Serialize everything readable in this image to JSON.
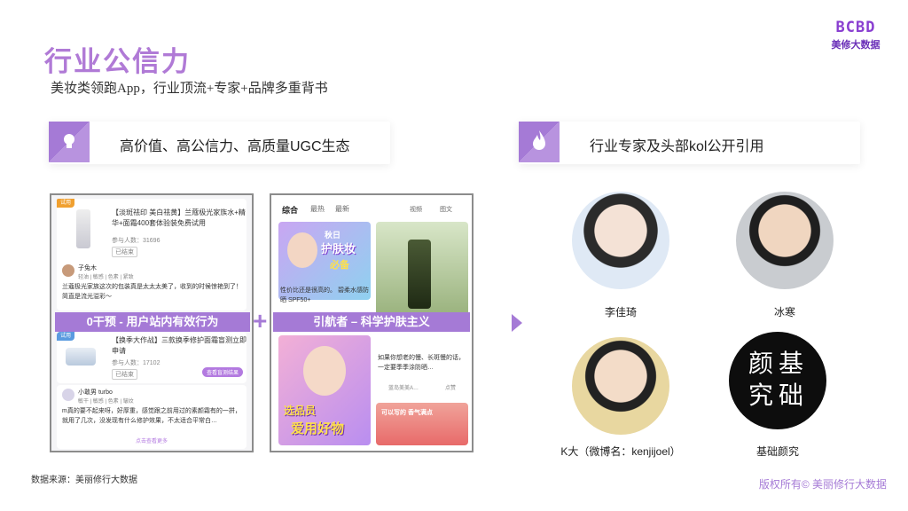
{
  "header": {
    "title": "行业公信力",
    "subtitle": "美妆类领跑App，行业顶流+专家+品牌多重背书",
    "logo_mark": "BCBD",
    "logo_text": "美修大数据"
  },
  "left_section": {
    "banner": "高价值、高公信力、高质量UGC生态",
    "icon": "lightbulb-icon",
    "screenshot1": {
      "badge_top": "试用",
      "item1_title": "【淡斑祛印 美白祛黄】兰蔻极光家族水+精华+面霜400套体验装免费试用",
      "item1_meta": "参与人数：31696",
      "item1_status": "已结束",
      "user1_name": "子兔木",
      "user1_tags": "轻油 | 敏感 | 色素 | 紧致",
      "user1_text": "兰蔻极光家族这次的包装真是太太太美了，收到的时候惊艳到了！简直是流光溢彩～",
      "strip": "0干预 - 用户站内有效行为",
      "badge_mid": "试用",
      "item2_title": "【换季大作战】三款换季修护面霜盲测立即申请",
      "item2_meta": "参与人数：17102",
      "item2_status": "已结束",
      "item2_button": "查看盲测结果",
      "user2_name": "小敢男 turbo",
      "user2_tags": "敏干 | 敏感 | 色素 | 皱纹",
      "user2_text": "m真的要不起来呀，好厚重，感觉跟之前用过的素颜霜有的一拼，就用了几次，没发现有什么修护效果，不太适合平常白…",
      "more": "点击查看更多"
    },
    "plus": "+",
    "screenshot2": {
      "tabs": [
        "综合",
        "最热",
        "最新"
      ],
      "tab_right1": "视频",
      "tab_right2": "图文",
      "poster1_line1": "秋日",
      "poster1_line2": "护肤妆",
      "poster1_line3": "必备",
      "card1_text": "性价比还是很高的。 碧柔水感防晒 SPF50+",
      "strip": "引航者 – 科学护肤主义",
      "poster2_line1": "选品员",
      "poster2_line2": "爱用好物",
      "card2_text": "如果你想老的慢、长斑慢的话，一定要季季涂防晒…",
      "card2_user": "蓝岛美美A…",
      "card2_likes": "点赞",
      "card3_text": "可以写的 香气满点"
    }
  },
  "right_section": {
    "banner": "行业专家及头部kol公开引用",
    "icon": "flame-icon",
    "experts": [
      {
        "name": "李佳琦"
      },
      {
        "name": "冰寒"
      },
      {
        "name": "K大（微博名：kenjijoel）"
      },
      {
        "name": "基础颜究"
      }
    ],
    "logo_chars": [
      "颜",
      "基",
      "究",
      "础"
    ]
  },
  "footer": {
    "source": "数据来源：美丽修行大数据",
    "copyright": "版权所有© 美丽修行大数据"
  },
  "colors": {
    "accent": "#a57ad6",
    "title": "#b07ad6",
    "brand": "#8a3fd1"
  }
}
